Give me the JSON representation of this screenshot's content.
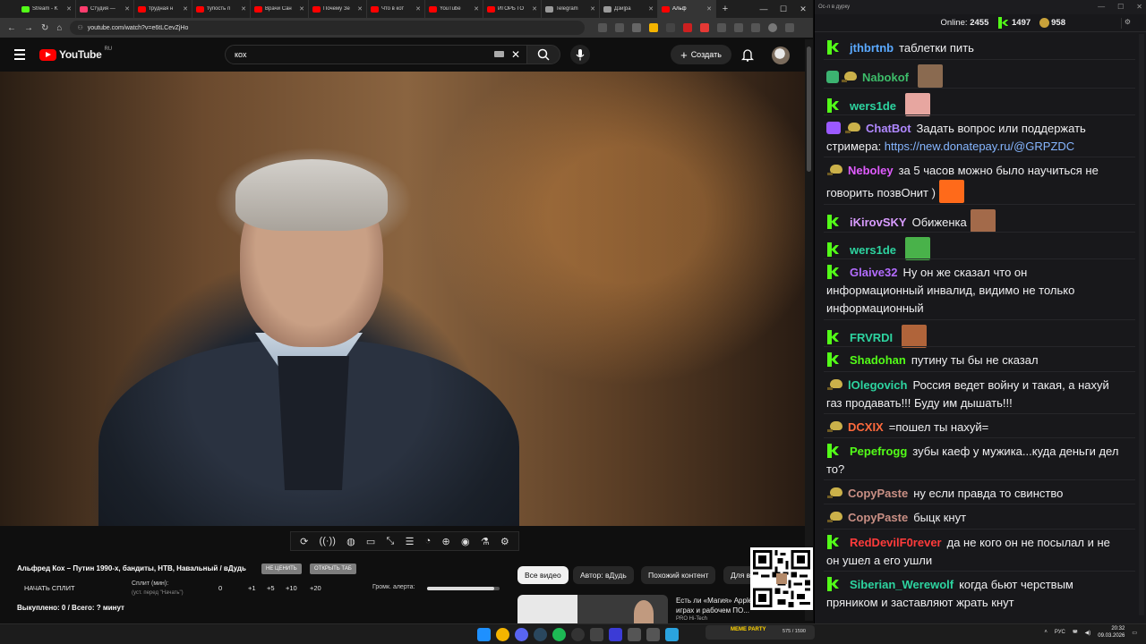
{
  "browser": {
    "tabs": [
      {
        "label": "Stream - K",
        "color": "#53fc18"
      },
      {
        "label": "Студия —",
        "color": "#ff3d6e"
      },
      {
        "label": "трудная н",
        "color": "#ff0000"
      },
      {
        "label": "тупость п",
        "color": "#ff0000"
      },
      {
        "label": "Врачи Сан",
        "color": "#ff0000"
      },
      {
        "label": "Почему Зе",
        "color": "#ff0000"
      },
      {
        "label": "Что в кот",
        "color": "#ff0000"
      },
      {
        "label": "YouTube",
        "color": "#ff0000"
      },
      {
        "label": "ИГОРЬ ГО",
        "color": "#ff0000"
      },
      {
        "label": "Telegram",
        "color": "#9a9a9a"
      },
      {
        "label": "Дзи|ра",
        "color": "#9a9a9a"
      },
      {
        "label": "Альф",
        "color": "#ff0000",
        "active": true
      }
    ],
    "url": "youtube.com/watch?v=e6tLCevZjHo"
  },
  "youtube": {
    "logo": "YouTube",
    "region": "RU",
    "search_value": "кох",
    "create_label": "Создать"
  },
  "video_tools": [
    "⟳",
    "((·))",
    "◍",
    "▭",
    "⤡",
    "☰",
    "◔",
    "⊕",
    "◉",
    "⚗",
    "⚙"
  ],
  "split": {
    "title": "Альфред Кох – Путин 1990-х, бандиты, НТВ, Навальный / вДудь",
    "pill1": "НЕ ЦЕНИТЬ",
    "pill2": "ОТКРЫТЬ ТАБ",
    "start_label": "НАЧАТЬ СПЛИТ",
    "split_label": "Сплит (мин):",
    "split_sub": "(уст. перед \"Начать\")",
    "values": [
      "0",
      "+1",
      "+5",
      "+10",
      "+20"
    ],
    "volume_label": "Громк. алерта:",
    "volume_level": 0.92,
    "done": "Выкуплено: 0 / Всего: ? минут"
  },
  "chips": [
    "Все видео",
    "Автор: вДудь",
    "Похожий контент",
    "Для в"
  ],
  "recommendation": {
    "title": "Есть ли «Магия» Apple? Тест в играх и рабочем ПО...",
    "sub": "PRO Hi-Tech"
  },
  "chat": {
    "window_title": "Ос-л в дурку",
    "online_label": "Online:",
    "online_count": "2455",
    "kick_count": "1497",
    "coin_count": "958",
    "messages": [
      {
        "user": "jthbrtnb",
        "color": "#5aa9ff",
        "text": "таблетки пить",
        "badge": "k"
      },
      {
        "user": "Nabokof",
        "color": "#3dbd6a",
        "text": "",
        "badge": "shield",
        "emote": "#8a6a50"
      },
      {
        "user": "wers1de",
        "color": "#2dd4a0",
        "text": "",
        "badge": "k",
        "emote": "#e7a6a0"
      },
      {
        "user": "ChatBot",
        "color": "#b088ff",
        "text": "Задать вопрос или поддержать стримера: ",
        "link": "https://new.donatepay.ru/@GRPZDC",
        "badge": "bot"
      },
      {
        "user": "Neboley",
        "color": "#e05cff",
        "text": "за 5 часов можно было научиться не говорить позвОнит )",
        "badge": "coin",
        "emote": "#ff6a1a"
      },
      {
        "user": "iKirovSKY",
        "color": "#d99cff",
        "text": "Обиженка",
        "badge": "k",
        "emote": "#a36a4a"
      },
      {
        "user": "wers1de",
        "color": "#2dd4a0",
        "text": "",
        "badge": "k",
        "emote": "#49b24a"
      },
      {
        "user": "Glaive32",
        "color": "#b36cff",
        "text": "Ну он же сказал что он информационный инвалид, видимо не только информационный",
        "badge": "k"
      },
      {
        "user": "FRVRDI",
        "color": "#2dd4a0",
        "text": "",
        "badge": "k",
        "emote": "#b0643a"
      },
      {
        "user": "Shadohan",
        "color": "#53fc18",
        "text": "путину ты бы не сказал",
        "badge": "k"
      },
      {
        "user": "lOlegovich",
        "color": "#2dd4a0",
        "text": "Россия ведет войну и такая, а нахуй газ продавать!!! Буду им дышать!!!",
        "badge": "coin"
      },
      {
        "user": "DCXIX",
        "color": "#ff6a3d",
        "text": "=пошел ты нахуй=",
        "badge": "coin"
      },
      {
        "user": "Pepefrogg",
        "color": "#53fc18",
        "text": "зубы каеф у мужика...куда деньги дел то?",
        "badge": "k"
      },
      {
        "user": "CopyPaste",
        "color": "#c98f84",
        "text": "ну если правда то свинство",
        "badge": "coin"
      },
      {
        "user": "CopyPaste",
        "color": "#c98f84",
        "text": "быцк кнут",
        "badge": "coin"
      },
      {
        "user": "RedDevilF0rever",
        "color": "#ff3b3b",
        "text": "да не кого он не посылал и не он ушел а его ушли",
        "badge": "k"
      },
      {
        "user": "Siberian_Werewolf",
        "color": "#2dd4a0",
        "text": "когда бьют черствым пряником и заставляют жрать кнут",
        "badge": "k"
      }
    ]
  },
  "taskbar": {
    "widget_label": "MEME PARTY",
    "widget_count": "575 / 1590",
    "lang": "РУС",
    "time": "20:32",
    "date": "09.03.2026"
  }
}
